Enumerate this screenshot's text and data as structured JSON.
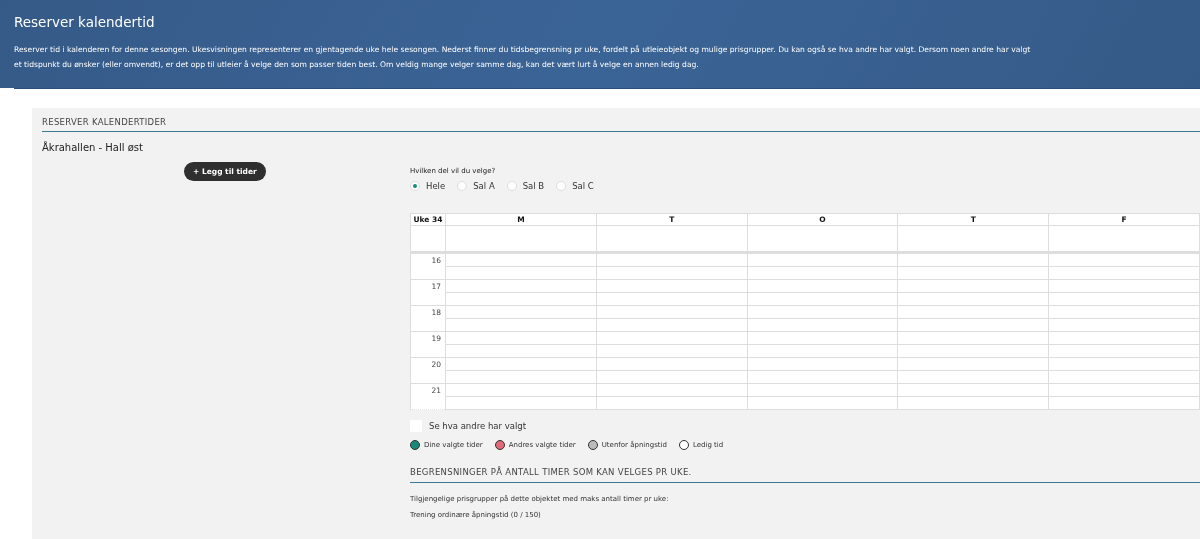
{
  "header": {
    "title": "Reserver kalendertid",
    "description": "Reserver tid i kalenderen for denne sesongen. Ukesvisningen representerer en gjentagende uke hele sesongen. Nederst finner du tidsbegrensning pr uke, fordelt på utleieobjekt og mulige prisgrupper. Du kan også se hva andre har valgt. Dersom noen andre har valgt et tidspunkt du ønsker (eller omvendt), er det opp til utleier å velge den som passer tiden best. Om veldig mange velger samme dag, kan det vært lurt å velge en annen ledig dag."
  },
  "section_title": "RESERVER KALENDERTIDER",
  "facility": "Åkrahallen - Hall øst",
  "add_button": "+ Legg til tider",
  "part_question": "Hvilken del vil du velge?",
  "parts": [
    {
      "label": "Hele",
      "selected": true
    },
    {
      "label": "Sal A",
      "selected": false
    },
    {
      "label": "Sal B",
      "selected": false
    },
    {
      "label": "Sal C",
      "selected": false
    }
  ],
  "calendar": {
    "week": "Uke 34",
    "days": [
      "M",
      "T",
      "O",
      "T",
      "F"
    ],
    "hours": [
      "16",
      "17",
      "18",
      "19",
      "20",
      "21"
    ]
  },
  "show_others": {
    "label": "Se hva andre har valgt",
    "checked": false
  },
  "legend": [
    {
      "label": "Dine valgte tider",
      "color": "#1a8a78"
    },
    {
      "label": "Andres valgte tider",
      "color": "#e06a78"
    },
    {
      "label": "Utenfor åpningstid",
      "color": "#bbbbbb"
    },
    {
      "label": "Ledig tid",
      "color": "#ffffff"
    }
  ],
  "limits": {
    "title": "BEGRENSNINGER PÅ ANTALL TIMER SOM KAN VELGES PR UKE.",
    "intro": "Tilgjengelige prisgrupper på dette objektet med maks antall timer pr uke:",
    "groups": [
      "Trening ordinære åpningstid (0 / 150)"
    ]
  }
}
